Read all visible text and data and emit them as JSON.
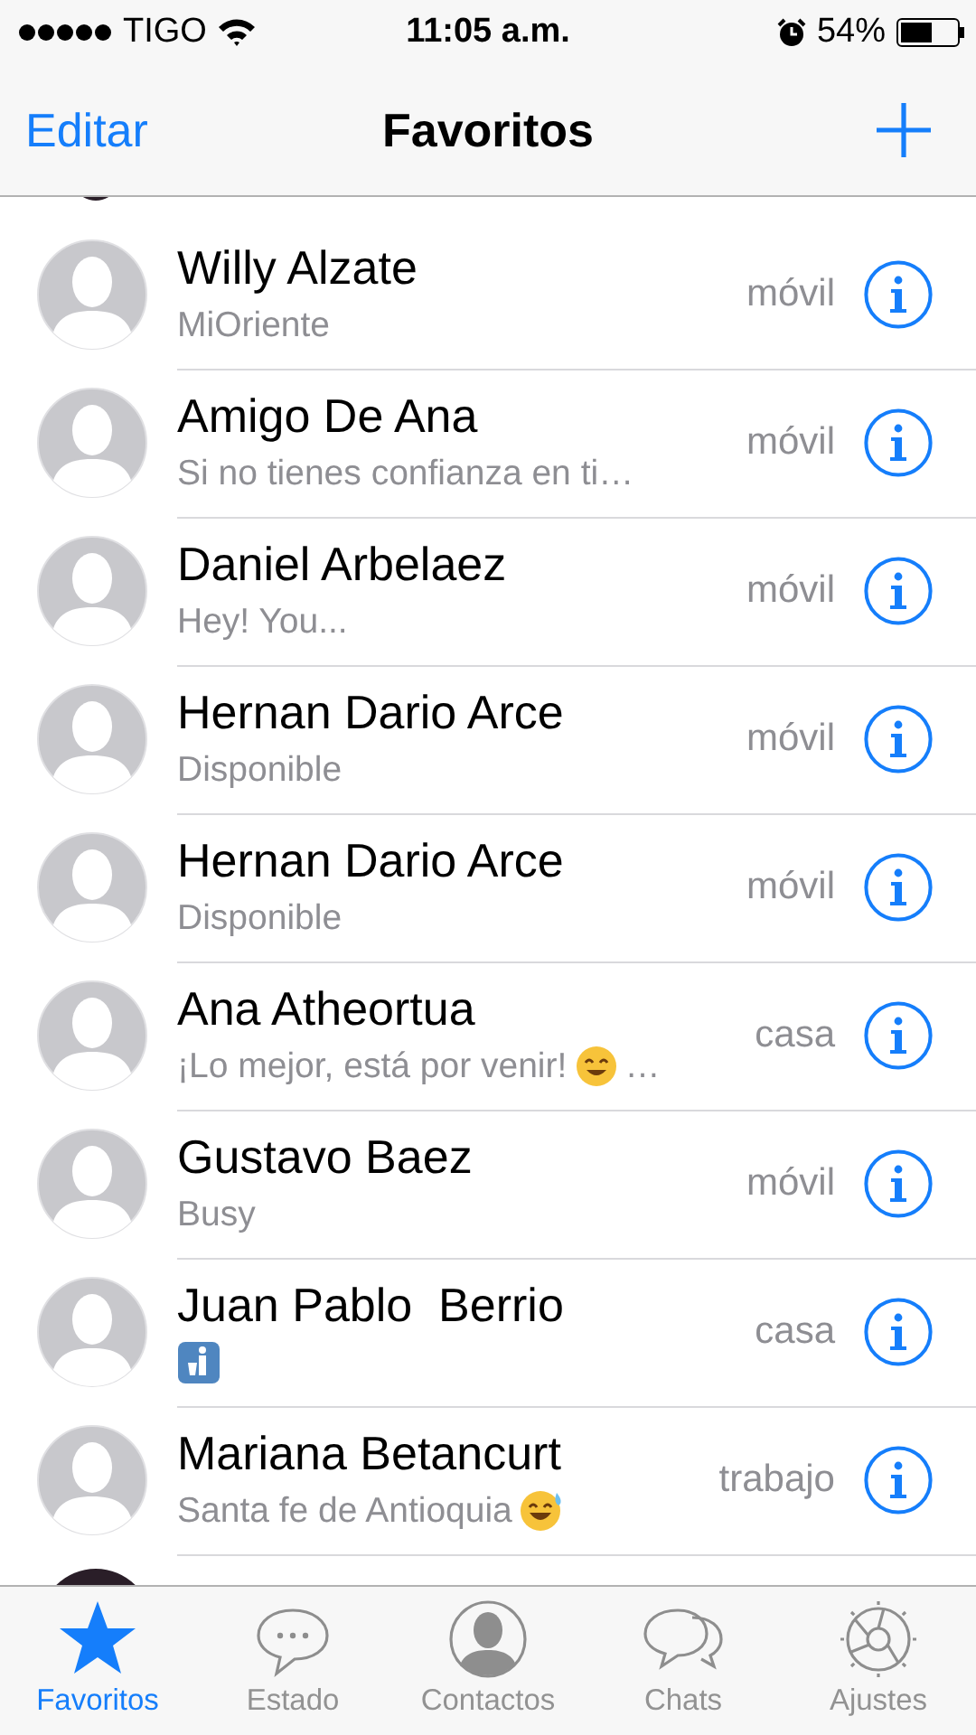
{
  "status_bar": {
    "carrier": "TIGO",
    "time": "11:05 a.m.",
    "battery": "54%"
  },
  "nav": {
    "left": "Editar",
    "title": "Favoritos"
  },
  "contacts": [
    {
      "kind": "plain",
      "name": "Willy Alzate",
      "status": "MiOriente",
      "label": "móvil"
    },
    {
      "kind": "plain",
      "name": "Amigo De Ana",
      "status": "Si no tienes confianza en ti…",
      "label": "móvil"
    },
    {
      "kind": "plain",
      "name": "Daniel Arbelaez",
      "status": "Hey! You...",
      "label": "móvil"
    },
    {
      "kind": "plain",
      "name": "Hernan Dario Arce",
      "status": "Disponible",
      "label": "móvil"
    },
    {
      "kind": "plain",
      "name": "Hernan Dario Arce",
      "status": "Disponible",
      "label": "móvil"
    },
    {
      "kind": "smile",
      "name": "Ana Atheortua",
      "status": "¡Lo mejor, está por venir!",
      "status_end": "…",
      "label": "casa"
    },
    {
      "kind": "plain",
      "name": "Gustavo Baez",
      "status": "Busy",
      "label": "móvil"
    },
    {
      "kind": "litter",
      "name": "Juan Pablo  Berrio",
      "label": "casa"
    },
    {
      "kind": "sweat",
      "name": "Mariana Betancurt",
      "status": "Santa fe de Antioquia",
      "label": "trabajo"
    }
  ],
  "tabs": [
    {
      "label": "Favoritos",
      "selected": true
    },
    {
      "label": "Estado",
      "selected": false
    },
    {
      "label": "Contactos",
      "selected": false
    },
    {
      "label": "Chats",
      "selected": false
    },
    {
      "label": "Ajustes",
      "selected": false
    }
  ]
}
